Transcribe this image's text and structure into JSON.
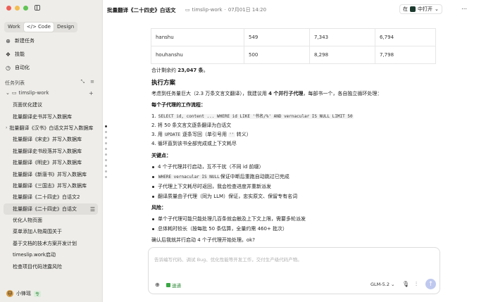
{
  "window": {
    "traffic_colors": [
      "#ee5f57",
      "#f5bd4f",
      "#61c454"
    ]
  },
  "sidebar": {
    "modes": [
      "Work",
      "</> Code",
      "Design"
    ],
    "active_mode_index": 1,
    "nav": [
      {
        "icon": "plus-circle-icon",
        "label": "新建任务"
      },
      {
        "icon": "skills-icon",
        "label": "技能"
      },
      {
        "icon": "clock-icon",
        "label": "自动化"
      }
    ],
    "tasks_title": "任务列表",
    "project_name": "timslip-work",
    "tasks": [
      "页面优化建议",
      "批量翻译史书并写入数据库",
      "批量翻译《汉书》白话文并写入数据库",
      "批量翻译《宋史》并写入数据库",
      "批量翻译史书段落并写入数据库",
      "批量翻译《明史》并写入数据库",
      "批量翻译《新唐书》并写入数据库",
      "批量翻译《三国志》并写入数据库",
      "批量翻译《二十四史》白话文2",
      "批量翻译《二十四史》白话文",
      "优化人物页面",
      "菜单添加人物周围关于",
      "基于文档的技术方案开发计划",
      "timeslip.work启动",
      "检查项目代码泄露风险"
    ],
    "active_task_index": 9,
    "user": {
      "name": "小锋瑶",
      "badge": "专"
    }
  },
  "topbar": {
    "title": "批量翻译《二十四史》白话文",
    "project": "timslip-work",
    "date": "07月01日 14:20",
    "open_label": "中打开",
    "open_prefix": "在"
  },
  "table": [
    [
      "hanshu",
      "549",
      "7,343",
      "6,794"
    ],
    [
      "houhanshu",
      "500",
      "8,298",
      "7,798"
    ]
  ],
  "message": {
    "remaining_prefix": "合计剩余约 ",
    "remaining_count": "23,047 条",
    "remaining_suffix": "。",
    "plan_heading": "执行方案",
    "plan_intro_a": "考虑到任务量巨大（2.3 万条文言文翻译），我建议用 ",
    "plan_intro_b": "4 个并行子代理",
    "plan_intro_c": "，每部书一个，各自独立循环处理：",
    "flow_heading": "每个子代理的工作流程：",
    "step1_prefix": "1. ",
    "step1_code": "SELECT id, content ... WHERE id LIKE '书名/%' AND vernacular IS NULL LIMIT 50",
    "step2": "2. 将 50 条文言文逐条翻译为白话文",
    "step3_a": "3. 用 ",
    "step3_code1": "UPDATE",
    "step3_b": " 逐条写回（单引号用 ",
    "step3_code2": "''",
    "step3_c": " 转义）",
    "step4": "4. 循环直到该书全部完成或上下文耗尽",
    "points_heading": "关键点：",
    "point1": "4 个子代理并行启动，互不干扰（不同 id 前缀）",
    "point2_code": "WHERE vernacular IS NULL",
    "point2_text": " 保证中断后重跑自动跳过已完成",
    "point3": "子代理上下文耗尽时返回，我会检查进度并重新派发",
    "point4": "翻译质量由子代理（同为 LLM）保证，忠实原文、保留专有名词",
    "risk_heading": "风险：",
    "risk1": "单个子代理可能只能处理几百条就会触及上下文上限，需要多轮派发",
    "risk2": "总体耗时较长（按每批 50 条估算，全量约需 460+ 批次）",
    "confirm": "确认后我就并行启动 4 个子代理开始处理。ok?"
  },
  "composer": {
    "placeholder": "告诉编写代码、调试 Bug、优化性能等开发工作，交付生产级代码产物。",
    "speed_label": "速通",
    "model_label": "GLM-5.2 ⌄",
    "accent": "#bfc9ef"
  }
}
